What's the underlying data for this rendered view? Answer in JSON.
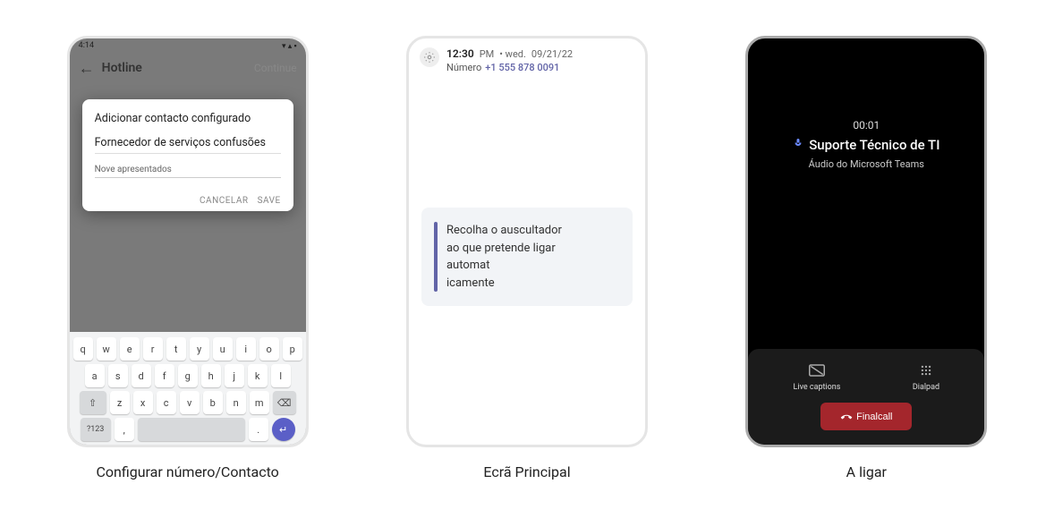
{
  "captions": {
    "screen1": "Configurar número/Contacto",
    "screen2": "Ecrã Principal",
    "screen3": "A ligar"
  },
  "screen1": {
    "status_time": "4:14",
    "topbar_title": "Hotline",
    "topbar_continue": "Continue",
    "modal": {
      "title": "Adicionar contacto configurado",
      "subtitle": "Fornecedor de serviços confusões",
      "field_label": "Nove apresentados",
      "cancel": "CANCELAR",
      "save": "SAVE"
    },
    "keyboard": {
      "row1": [
        "q",
        "w",
        "e",
        "r",
        "t",
        "y",
        "u",
        "i",
        "o",
        "p"
      ],
      "row2": [
        "a",
        "s",
        "d",
        "f",
        "g",
        "h",
        "j",
        "k",
        "l"
      ],
      "row3_shift": "⇧",
      "row3": [
        "z",
        "x",
        "c",
        "v",
        "b",
        "n",
        "m"
      ],
      "row3_bksp": "⌫",
      "row4_sym": "?123",
      "row4_comma": ",",
      "row4_period": ".",
      "row4_enter": "↵"
    }
  },
  "screen2": {
    "time": "12:30",
    "ampm": "PM",
    "date_prefix": "• wed.",
    "date": "09/21/22",
    "number_label": "Número",
    "number": "+1 555 878 0091",
    "card_message": "Recolha o auscultador\nao que pretende ligar\n    automat\n  icamente"
  },
  "screen3": {
    "timer": "00:01",
    "name": "Suporte Técnico de TI",
    "subtitle": "Áudio do Microsoft Teams",
    "live_captions": "Live captions",
    "dialpad": "Dialpad",
    "end_call": "Finalcall"
  }
}
